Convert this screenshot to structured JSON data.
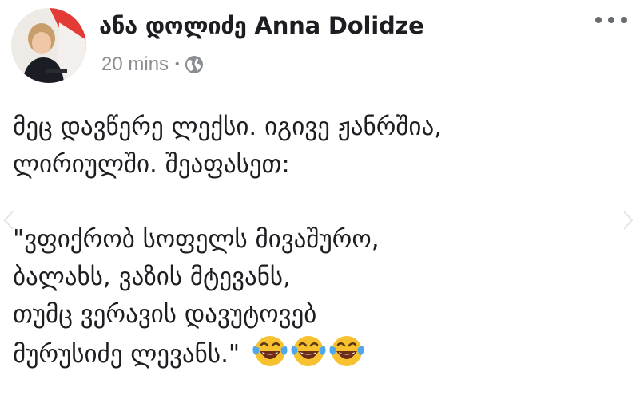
{
  "author": {
    "name": "ანა დოლიძე Anna Dolidze",
    "avatar": "profile-photo"
  },
  "meta": {
    "time": "20 mins",
    "separator": "•",
    "privacy_icon": "globe-icon"
  },
  "actions": {
    "more_icon": "ellipsis-icon"
  },
  "post": {
    "intro": [
      "მეც დავწერე ლექსი. იგივე ჟანრშია,",
      "ლირიულში. შეაფასეთ:"
    ],
    "poem": [
      "\"ვფიქრობ სოფელს მივაშურო,",
      "ბალახს, ვაზის მტევანს,",
      "თუმც ვერავის დავუტოვებ",
      "მურუსიძე ლევანს.\""
    ],
    "reaction_emoji": "face-with-tears-of-joy",
    "emoji_count": 3
  },
  "colors": {
    "text": "#1c1e21",
    "meta": "#8a8d91",
    "emoji_face": "#f7c12f",
    "tears": "#4fa8ec"
  }
}
